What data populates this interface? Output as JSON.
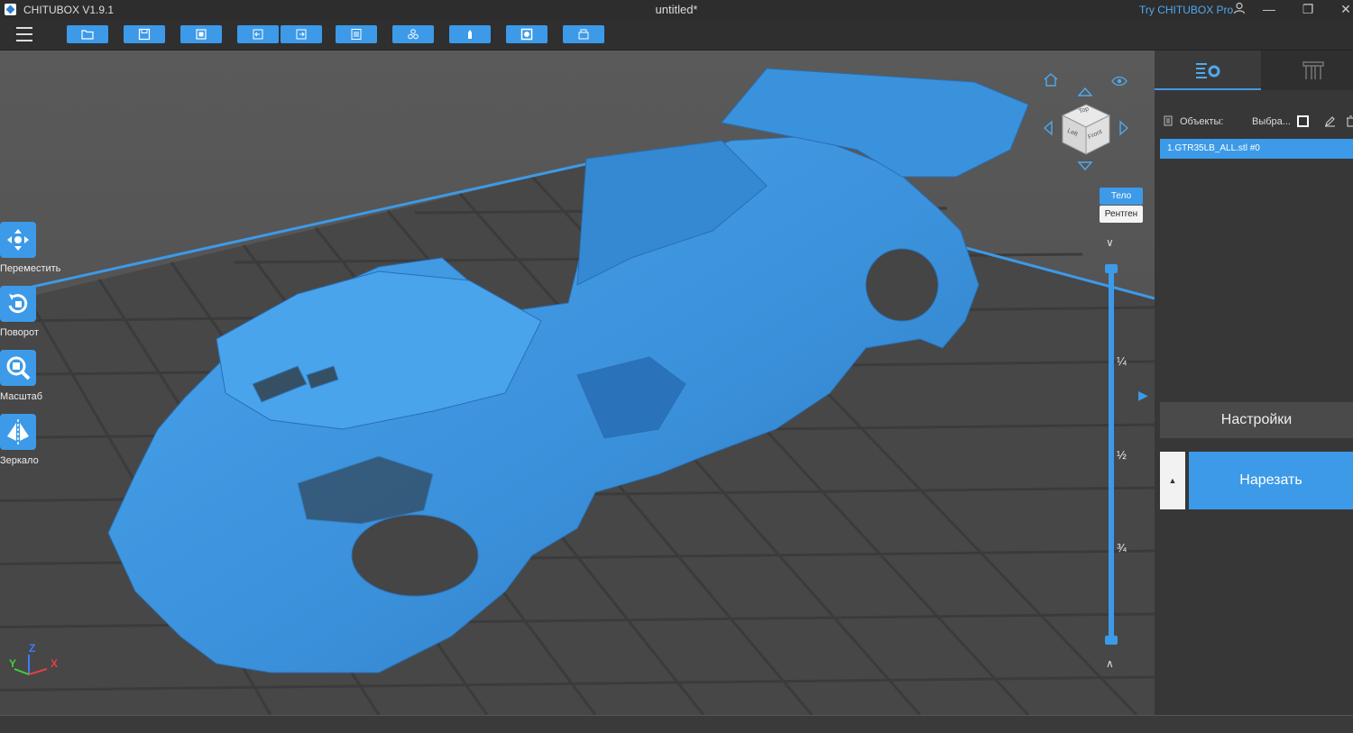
{
  "titlebar": {
    "app_name": "CHITUBOX V1.9.1",
    "document": "untitled*",
    "promo": "Try CHITUBOX Pro",
    "min": "—",
    "max": "❐",
    "close": "✕"
  },
  "toolbar": {
    "buttons": [
      "open-file",
      "save",
      "screenshot",
      "undo",
      "redo",
      "model-list",
      "auto-layout",
      "auto-support",
      "hollow",
      "printer"
    ]
  },
  "left_tools": [
    {
      "name": "move",
      "label": "Переместить"
    },
    {
      "name": "rotate",
      "label": "Поворот"
    },
    {
      "name": "scale",
      "label": "Масштаб"
    },
    {
      "name": "mirror",
      "label": "Зеркало"
    }
  ],
  "view_cube": {
    "top": "Top",
    "left": "Left",
    "front": "Front"
  },
  "render_modes": {
    "body": "Тело",
    "xray": "Рентген"
  },
  "layer_slider": {
    "top_layer_fraction": 1.0,
    "bottom_layer_fraction": 0.0,
    "marks": [
      "¼",
      "½",
      "¾"
    ]
  },
  "axes": {
    "x": "X",
    "y": "Y",
    "z": "Z"
  },
  "right_panel": {
    "objects_label": "Объекты:",
    "select_label": "Выбра...",
    "objects": [
      "1.GTR35LB_ALL.stl #0"
    ],
    "settings_button": "Настройки",
    "slice_button": "Нарезать"
  },
  "colors": {
    "accent": "#3c9ae8",
    "model": "#3a8fd9",
    "plate_border": "#3c9ae8",
    "viewport_bg": "#505050"
  }
}
